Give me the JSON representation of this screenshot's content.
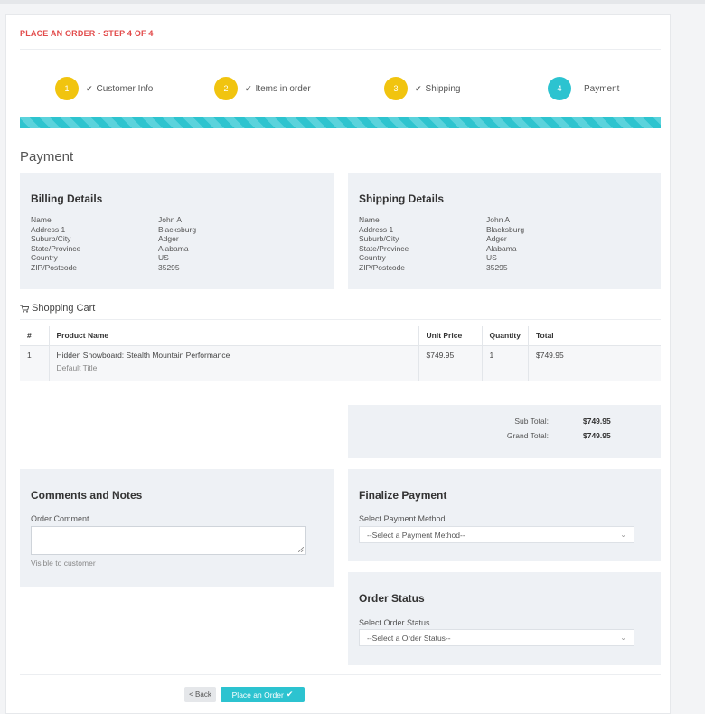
{
  "header": {
    "title": "PLACE AN ORDER - STEP 4 OF 4"
  },
  "steps": [
    {
      "num": "1",
      "label": "Customer Info",
      "state": "done"
    },
    {
      "num": "2",
      "label": "Items in order",
      "state": "done"
    },
    {
      "num": "3",
      "label": "Shipping",
      "state": "done"
    },
    {
      "num": "4",
      "label": "Payment",
      "state": "active"
    }
  ],
  "progress": {
    "percent": 100
  },
  "page_heading": "Payment",
  "billing": {
    "title": "Billing Details",
    "fields": [
      {
        "label": "Name",
        "value": "John A"
      },
      {
        "label": "Address 1",
        "value": "Blacksburg"
      },
      {
        "label": "Suburb/City",
        "value": "Adger"
      },
      {
        "label": "State/Province",
        "value": "Alabama"
      },
      {
        "label": "Country",
        "value": "US"
      },
      {
        "label": "ZIP/Postcode",
        "value": "35295"
      }
    ]
  },
  "shipping": {
    "title": "Shipping Details",
    "fields": [
      {
        "label": "Name",
        "value": "John A"
      },
      {
        "label": "Address 1",
        "value": "Blacksburg"
      },
      {
        "label": "Suburb/City",
        "value": "Adger"
      },
      {
        "label": "State/Province",
        "value": "Alabama"
      },
      {
        "label": "Country",
        "value": "US"
      },
      {
        "label": "ZIP/Postcode",
        "value": "35295"
      }
    ]
  },
  "cart": {
    "title": "Shopping Cart",
    "icon": "cart-icon",
    "columns": [
      "#",
      "Product Name",
      "Unit Price",
      "Quantity",
      "Total"
    ],
    "rows": [
      {
        "num": "1",
        "product": "Hidden Snowboard: Stealth Mountain Performance",
        "variant": "Default Title",
        "unit_price": "$749.95",
        "quantity": "1",
        "total": "$749.95"
      }
    ]
  },
  "totals": {
    "subtotal_label": "Sub Total:",
    "subtotal": "$749.95",
    "grand_label": "Grand Total:",
    "grand": "$749.95"
  },
  "comments": {
    "title": "Comments and Notes",
    "field_label": "Order Comment",
    "value": "",
    "help": "Visible to customer"
  },
  "payment": {
    "title": "Finalize Payment",
    "field_label": "Select Payment Method",
    "selected": "--Select a Payment Method--"
  },
  "order_status": {
    "title": "Order Status",
    "field_label": "Select Order Status",
    "selected": "--Select a Order Status--"
  },
  "actions": {
    "back": "< Back",
    "place": "Place an Order"
  },
  "colors": {
    "accent": "#2cc3d0",
    "step_done": "#f1c40f",
    "title_red": "#e24a4a",
    "panel_bg": "#eef1f5"
  }
}
